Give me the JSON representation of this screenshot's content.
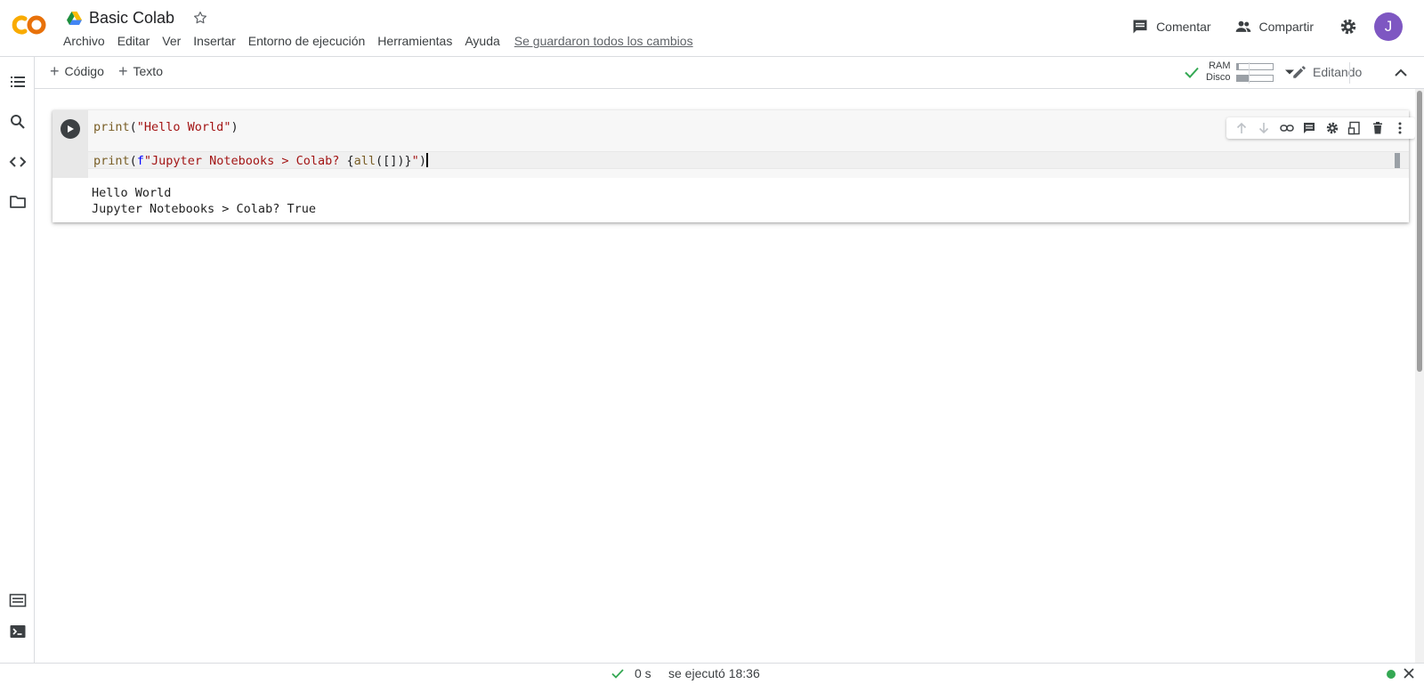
{
  "app": {
    "logo": "colab-logo",
    "notebook_title": "Basic Colab",
    "drive_icon": "google-drive-icon"
  },
  "menu": {
    "items": [
      "Archivo",
      "Editar",
      "Ver",
      "Insertar",
      "Entorno de ejecución",
      "Herramientas",
      "Ayuda"
    ],
    "save_status": "Se guardaron todos los cambios"
  },
  "header": {
    "comment_label": "Comentar",
    "share_label": "Compartir",
    "avatar_initial": "J",
    "avatar_color": "#7e57c2"
  },
  "toolbar": {
    "add_code_label": "Código",
    "add_text_label": "Texto",
    "ram_label": "RAM",
    "disk_label": "Disco",
    "ram_usage": 0.05,
    "disk_usage": 0.35,
    "editing_label": "Editando"
  },
  "sidebar": {
    "icons": [
      "table-of-contents-icon",
      "search-icon",
      "code-snippets-icon",
      "files-icon",
      "command-palette-icon",
      "terminal-icon"
    ]
  },
  "cell": {
    "code_line_1": {
      "fn": "print",
      "open": "(",
      "str": "\"Hello World\"",
      "close": ")"
    },
    "code_line_2": {
      "fn": "print",
      "open": "(",
      "prefix": "f",
      "str_a": "\"Jupyter Notebooks > Colab? ",
      "expr": "{",
      "fn2": "all",
      "expr2": "([])}",
      "str_b": "\"",
      "close": ")"
    },
    "output": "Hello World\nJupyter Notebooks > Colab? True",
    "tools": [
      "move-up-icon",
      "move-down-icon",
      "link-icon",
      "comment-icon",
      "settings-icon",
      "mirror-cell-icon",
      "delete-icon",
      "more-icon"
    ]
  },
  "status": {
    "duration": "0 s",
    "last_run": "se ejecutó 18:36",
    "connection_color": "#34a853"
  }
}
